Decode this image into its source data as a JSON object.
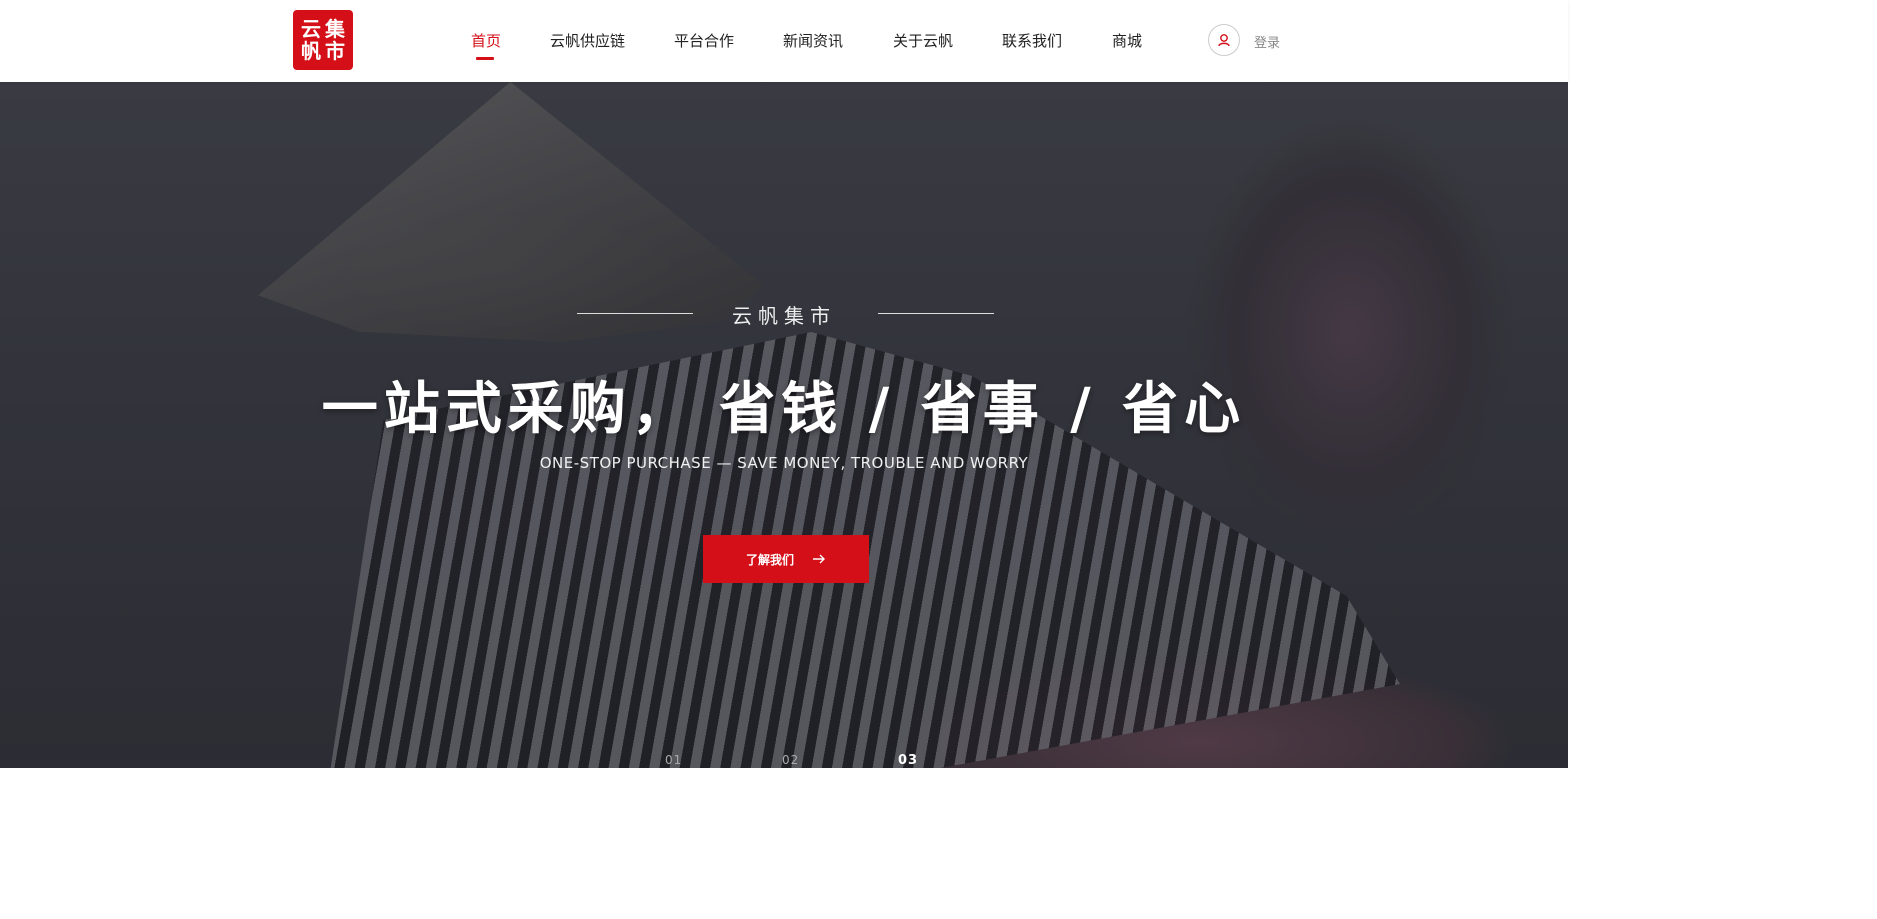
{
  "header": {
    "logo_lines": [
      "云帆",
      "集市"
    ],
    "nav": [
      {
        "label": "首页",
        "active": true
      },
      {
        "label": "云帆供应链",
        "active": false
      },
      {
        "label": "平台合作",
        "active": false
      },
      {
        "label": "新闻资讯",
        "active": false
      },
      {
        "label": "关于云帆",
        "active": false
      },
      {
        "label": "联系我们",
        "active": false
      },
      {
        "label": "商城",
        "active": false
      }
    ],
    "login_label": "登录",
    "user_icon": "user-icon"
  },
  "hero": {
    "subtitle": "云帆集市",
    "title": "一站式采购， 省钱 / 省事 / 省心",
    "english": "ONE-STOP PURCHASE — SAVE MONEY, TROUBLE AND WORRY",
    "cta_label": "了解我们",
    "cta_icon": "arrow-right-icon",
    "pager": [
      {
        "label": "01",
        "active": false
      },
      {
        "label": "02",
        "active": false
      },
      {
        "label": "03",
        "active": true
      }
    ]
  },
  "colors": {
    "accent": "#d40f18"
  }
}
